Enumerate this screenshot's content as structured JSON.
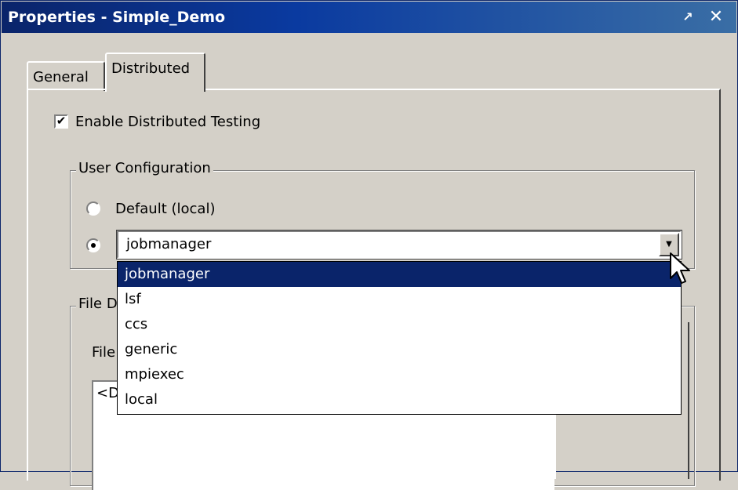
{
  "window": {
    "title": "Properties - Simple_Demo",
    "undock_glyph": "↗",
    "close_glyph": "✕"
  },
  "tabs": [
    {
      "label": "General",
      "active": false
    },
    {
      "label": "Distributed",
      "active": true
    }
  ],
  "enable_distributed": {
    "label": "Enable Distributed Testing",
    "checked": true,
    "glyph": "✔"
  },
  "user_configuration": {
    "legend": "User Configuration",
    "default_option": {
      "label": "Default (local)",
      "selected": false
    },
    "custom_option": {
      "selected": true
    },
    "combo": {
      "value": "jobmanager",
      "arrow_glyph": "▼",
      "options": [
        "jobmanager",
        "lsf",
        "ccs",
        "generic",
        "mpiexec",
        "local"
      ],
      "highlighted": "jobmanager"
    }
  },
  "file_group": {
    "legend": "File D",
    "label": "File",
    "list_item": "<D"
  },
  "colors": {
    "titlebar": "#0a246a",
    "dialog_bg": "#d4d0c8",
    "selection": "#0a246a"
  },
  "icons": [
    "undock-icon",
    "close-icon",
    "check-icon",
    "dropdown-arrow-icon",
    "mouse-cursor-icon"
  ]
}
